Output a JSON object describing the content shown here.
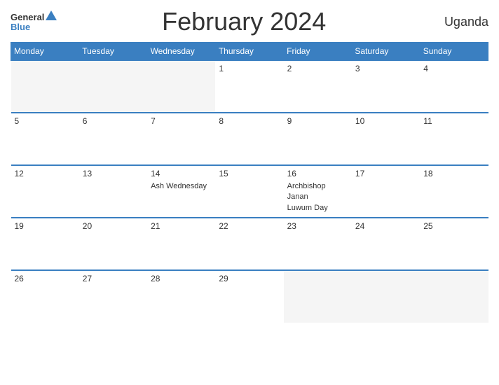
{
  "header": {
    "logo_general": "General",
    "logo_blue": "Blue",
    "title": "February 2024",
    "country": "Uganda"
  },
  "weekdays": [
    "Monday",
    "Tuesday",
    "Wednesday",
    "Thursday",
    "Friday",
    "Saturday",
    "Sunday"
  ],
  "weeks": [
    [
      {
        "date": "",
        "events": [],
        "empty": true
      },
      {
        "date": "",
        "events": [],
        "empty": true
      },
      {
        "date": "",
        "events": [],
        "empty": true
      },
      {
        "date": "1",
        "events": []
      },
      {
        "date": "2",
        "events": []
      },
      {
        "date": "3",
        "events": []
      },
      {
        "date": "4",
        "events": []
      }
    ],
    [
      {
        "date": "5",
        "events": []
      },
      {
        "date": "6",
        "events": []
      },
      {
        "date": "7",
        "events": []
      },
      {
        "date": "8",
        "events": []
      },
      {
        "date": "9",
        "events": []
      },
      {
        "date": "10",
        "events": []
      },
      {
        "date": "11",
        "events": []
      }
    ],
    [
      {
        "date": "12",
        "events": []
      },
      {
        "date": "13",
        "events": []
      },
      {
        "date": "14",
        "events": [
          "Ash Wednesday"
        ]
      },
      {
        "date": "15",
        "events": []
      },
      {
        "date": "16",
        "events": [
          "Archbishop Janan",
          "Luwum Day"
        ]
      },
      {
        "date": "17",
        "events": []
      },
      {
        "date": "18",
        "events": []
      }
    ],
    [
      {
        "date": "19",
        "events": []
      },
      {
        "date": "20",
        "events": []
      },
      {
        "date": "21",
        "events": []
      },
      {
        "date": "22",
        "events": []
      },
      {
        "date": "23",
        "events": []
      },
      {
        "date": "24",
        "events": []
      },
      {
        "date": "25",
        "events": []
      }
    ],
    [
      {
        "date": "26",
        "events": []
      },
      {
        "date": "27",
        "events": []
      },
      {
        "date": "28",
        "events": []
      },
      {
        "date": "29",
        "events": []
      },
      {
        "date": "",
        "events": [],
        "empty": true
      },
      {
        "date": "",
        "events": [],
        "empty": true
      },
      {
        "date": "",
        "events": [],
        "empty": true
      }
    ]
  ]
}
